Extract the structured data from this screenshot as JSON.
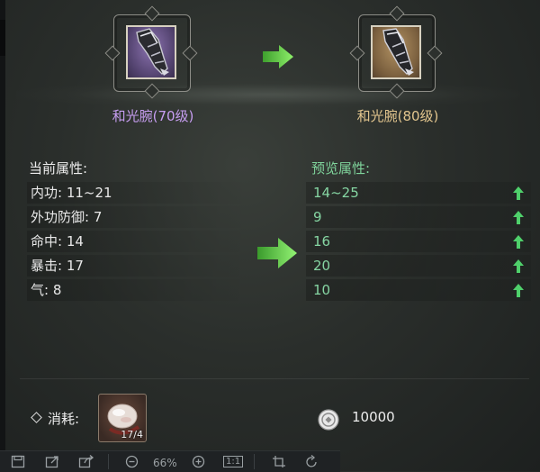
{
  "upgrade": {
    "from_item": {
      "name": "和光腕(70级)",
      "rarity_color": "#c69df0",
      "icon": "bracer-icon"
    },
    "to_item": {
      "name": "和光腕(80级)",
      "rarity_color": "#e2c58e",
      "icon": "bracer-icon"
    },
    "arrow_color": "#6fdc4a"
  },
  "current": {
    "title": "当前属性:",
    "stats": [
      {
        "text": "内功: 11~21"
      },
      {
        "text": "外功防御: 7"
      },
      {
        "text": "命中: 14"
      },
      {
        "text": "暴击: 17"
      },
      {
        "text": "气: 8"
      }
    ]
  },
  "preview": {
    "title": "预览属性:",
    "stats": [
      {
        "text": "14~25",
        "indicator": "up-arrow-icon"
      },
      {
        "text": "9",
        "indicator": "up-arrow-icon"
      },
      {
        "text": "16",
        "indicator": "up-arrow-icon"
      },
      {
        "text": "20",
        "indicator": "up-arrow-icon"
      },
      {
        "text": "10",
        "indicator": "up-arrow-icon"
      }
    ]
  },
  "cost": {
    "label": "消耗:",
    "material": {
      "icon": "jade-stone-icon",
      "count": "17/4"
    },
    "currency": {
      "icon": "coin-icon",
      "amount": "10000"
    }
  },
  "viewer_toolbar": {
    "zoom": "66%",
    "actual_size": "1:1",
    "icons": [
      "save-icon",
      "export-icon",
      "share-icon",
      "zoom-out-icon",
      "zoom-in-icon",
      "actual-size-icon",
      "crop-icon",
      "rotate-icon"
    ]
  }
}
